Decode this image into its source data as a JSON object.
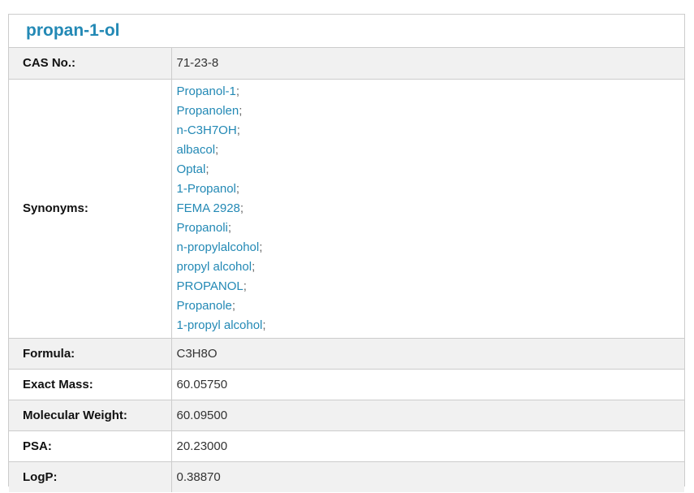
{
  "title": "propan-1-ol",
  "rows": {
    "cas": {
      "label": "CAS No.:",
      "value": "71-23-8"
    },
    "synonyms": {
      "label": "Synonyms:",
      "separator": ";",
      "items": [
        "Propanol-1",
        "Propanolen",
        "n-C3H7OH",
        "albacol",
        "Optal",
        "1-Propanol",
        "FEMA 2928",
        "Propanoli",
        "n-propylalcohol",
        "propyl alcohol",
        "PROPANOL",
        "Propanole",
        "1-propyl alcohol"
      ]
    },
    "formula": {
      "label": "Formula:",
      "value": "C3H8O"
    },
    "exact_mass": {
      "label": "Exact Mass:",
      "value": "60.05750"
    },
    "molecular_weight": {
      "label": "Molecular Weight:",
      "value": "60.09500"
    },
    "psa": {
      "label": "PSA:",
      "value": "20.23000"
    },
    "logp": {
      "label": "LogP:",
      "value": "0.38870"
    }
  },
  "colors": {
    "accent": "#2389b5",
    "border": "#cccccc",
    "row_shade": "#f1f1f1"
  }
}
